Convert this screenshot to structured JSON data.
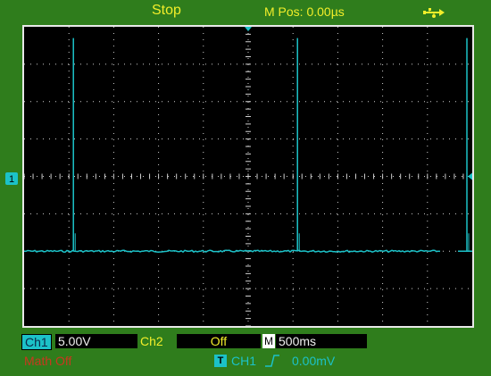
{
  "header": {
    "status": "Stop",
    "mpos": "M Pos: 0.00µs",
    "icon": "usb-icon"
  },
  "screen": {
    "grid": {
      "h_divisions": 10,
      "v_divisions": 8
    },
    "trace_color": "#1cc2c8",
    "ch1_marker": "1",
    "baseline_level_div": -2.0,
    "pulses": [
      {
        "time_div": 1.1,
        "level_div": 3.7
      },
      {
        "time_div": 6.1,
        "level_div": 3.7
      },
      {
        "time_div": 11.1,
        "level_div": 3.7
      }
    ]
  },
  "bottom": {
    "ch1_label": "Ch1",
    "ch1_scale": "5.00V",
    "ch2_label": "Ch2",
    "ch2_state": "Off",
    "m_label": "M",
    "timebase": "500ms",
    "math": "Math Off",
    "trigger_icon": "T",
    "trigger_source": "CH1",
    "trigger_level": "0.00mV"
  }
}
